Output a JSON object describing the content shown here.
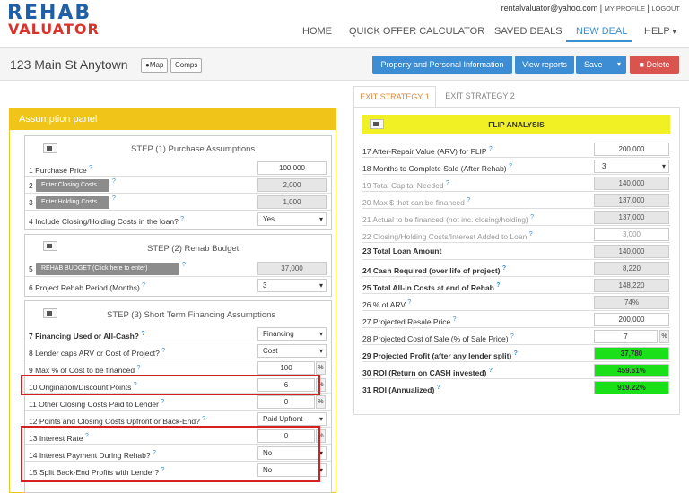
{
  "brand": {
    "line1": "REHAB",
    "line2": "VALUATOR"
  },
  "user": {
    "email": "rentalvaluator@yahoo.com",
    "sep": "|",
    "my_profile": "MY PROFILE",
    "logout": "LOGOUT"
  },
  "nav": {
    "home": "HOME",
    "qoc": "QUICK OFFER CALCULATOR",
    "saved": "SAVED DEALS",
    "new": "NEW DEAL",
    "help": "HELP"
  },
  "property": {
    "address": "123 Main St Anytown",
    "map_label": "Map",
    "comps_label": "Comps"
  },
  "actions": {
    "ppi": "Property and Personal Information",
    "reports": "View reports",
    "save": "Save",
    "delete": "Delete"
  },
  "panel": {
    "title": "Assumption panel"
  },
  "step1": {
    "title": "STEP (1) Purchase Assumptions",
    "r1": {
      "label": "1 Purchase Price",
      "value": "100,000"
    },
    "r2": {
      "num": "2",
      "button": "Enter Closing Costs",
      "value": "2,000"
    },
    "r3": {
      "num": "3",
      "button": "Enter Holding Costs",
      "value": "1,000"
    },
    "r4": {
      "label": "4 Include Closing/Holding Costs in the loan?",
      "value": "Yes"
    }
  },
  "step2": {
    "title": "STEP (2) Rehab Budget",
    "r5": {
      "num": "5",
      "button": "REHAB BUDGET (Click here to enter)",
      "value": "37,000"
    },
    "r6": {
      "label": "6 Project Rehab Period (Months)",
      "value": "3"
    }
  },
  "step3": {
    "title": "STEP (3) Short Term Financing Assumptions",
    "r7": {
      "label": "7   Financing Used or All-Cash?",
      "value": "Financing"
    },
    "r8": {
      "label": "8   Lender caps ARV or Cost of Project?",
      "value": "Cost"
    },
    "r9": {
      "label": "9   Max % of Cost to be financed",
      "value": "100",
      "unit": "%"
    },
    "r10": {
      "label": "10 Origination/Discount Points",
      "value": "6",
      "unit": "%"
    },
    "r11": {
      "label": "11 Other Closing Costs Paid to Lender",
      "value": "0",
      "unit": "%"
    },
    "r12": {
      "label": "12 Points and Closing Costs Upfront or Back-End?",
      "value": "Paid Upfront"
    },
    "r13": {
      "label": "13 Interest Rate",
      "value": "0",
      "unit": "%"
    },
    "r14": {
      "label": "14 Interest Payment During Rehab?",
      "value": "No"
    },
    "r15": {
      "label": "15 Split Back-End Profits with Lender?",
      "value": "No"
    }
  },
  "tabs": {
    "t1": "EXIT STRATEGY 1",
    "t2": "EXIT STRATEGY 2"
  },
  "flip": {
    "title": "FLIP ANALYSIS",
    "r17": {
      "label": "17  After-Repair Value (ARV) for FLIP",
      "value": "200,000"
    },
    "r18": {
      "label": "18  Months to Complete Sale (After Rehab)",
      "value": "3"
    },
    "r19": {
      "label": "19  Total Capital Needed",
      "value": "140,000"
    },
    "r20": {
      "label": "20  Max $ that can be financed",
      "value": "137,000"
    },
    "r21": {
      "label": "21  Actual to be financed (not inc. closing/holding)",
      "value": "137,000"
    },
    "r22": {
      "label": "22  Closing/Holding Costs/Interest Added to Loan",
      "value": "3,000"
    },
    "r23": {
      "label": "23  Total Loan Amount",
      "value": "140,000"
    },
    "r24": {
      "label": "24  Cash Required (over life of project)",
      "value": "8,220"
    },
    "r25": {
      "label": "25  Total All-in Costs at end of Rehab",
      "value": "148,220"
    },
    "r26": {
      "label": "26  % of ARV",
      "value": "74%"
    },
    "r27": {
      "label": "27  Projected Resale Price",
      "value": "200,000"
    },
    "r28": {
      "label": "28  Projected Cost of Sale (% of Sale Price)",
      "value": "7",
      "unit": "%"
    },
    "r29": {
      "label": "29  Projected Profit (after any lender split)",
      "value": "37,780"
    },
    "r30": {
      "label": "30  ROI (Return on CASH invested)",
      "value": "459.61%"
    },
    "r31": {
      "label": "31  ROI (Annualized)",
      "value": "919.22%"
    }
  },
  "colors": {
    "brand_blue": "#1e5fa8",
    "brand_red": "#d9342b",
    "panel_yellow": "#f0c419",
    "flip_yellow": "#f0f024",
    "green": "#19e019",
    "highlight_red": "#d42020"
  },
  "icons": {
    "map": "map-marker-icon",
    "video": "video-camera-icon",
    "trash": "trash-icon",
    "caret": "caret-down-icon"
  }
}
